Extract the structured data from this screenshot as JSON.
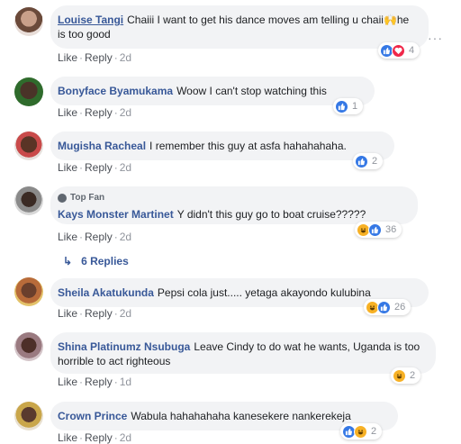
{
  "comments": [
    {
      "author": "Louise Tangi",
      "text": "Chaiii I want to get his dance moves am telling u chaii🙌he is too good",
      "like": "Like",
      "reply": "Reply",
      "time": "2d",
      "count": "4"
    },
    {
      "author": "Bonyface Byamukama",
      "text": "Woow I can't stop watching this",
      "like": "Like",
      "reply": "Reply",
      "time": "2d",
      "count": "1"
    },
    {
      "author": "Mugisha Racheal",
      "text": "I remember this guy at asfa hahahahaha.",
      "like": "Like",
      "reply": "Reply",
      "time": "2d",
      "count": "2"
    },
    {
      "author": "Kays Monster Martinet",
      "badge": "Top Fan",
      "text": "Y didn't this guy go to boat cruise?????",
      "like": "Like",
      "reply": "Reply",
      "time": "2d",
      "count": "36"
    },
    {
      "author": "Sheila Akatukunda",
      "text": "Pepsi cola just..... yetaga akayondo kulubina",
      "like": "Like",
      "reply": "Reply",
      "time": "2d",
      "count": "26"
    },
    {
      "author": "Shina Platinumz Nsubuga",
      "text": "Leave Cindy to do wat he wants, Uganda is too horrible to act righteous",
      "like": "Like",
      "reply": "Reply",
      "time": "1d",
      "count": "2"
    },
    {
      "author": "Crown Prince",
      "text": "Wabula hahahahaha kanesekere nankerekeja",
      "like": "Like",
      "reply": "Reply",
      "time": "2d",
      "count": "2"
    }
  ],
  "replies_label": "6 Replies",
  "more_icon": "ellipsis-icon",
  "colors": {
    "link": "#385898",
    "bubble": "#f2f3f5",
    "like": "#3578e5",
    "love": "#f0284a",
    "haha": "#f7b125"
  }
}
